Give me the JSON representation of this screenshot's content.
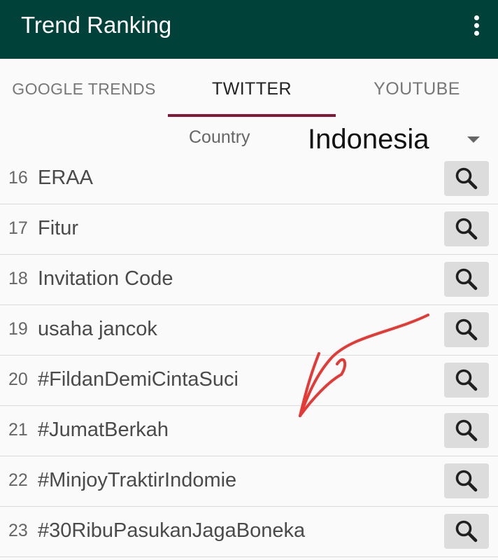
{
  "app": {
    "title": "Trend Ranking",
    "menu_icon": "more-vert-icon",
    "bar_color": "#00423a"
  },
  "tabs": [
    {
      "label": "GOOGLE TRENDS",
      "selected": false
    },
    {
      "label": "TWITTER",
      "selected": true
    },
    {
      "label": "YOUTUBE",
      "selected": false
    }
  ],
  "accent_color": "#8a1538",
  "country": {
    "label": "Country",
    "value": "Indonesia"
  },
  "trends": [
    {
      "rank": "16",
      "term": "ERAA"
    },
    {
      "rank": "17",
      "term": "Fitur"
    },
    {
      "rank": "18",
      "term": "Invitation Code"
    },
    {
      "rank": "19",
      "term": "usaha jancok"
    },
    {
      "rank": "20",
      "term": "#FildanDemiCintaSuci"
    },
    {
      "rank": "21",
      "term": "#JumatBerkah"
    },
    {
      "rank": "22",
      "term": "#MinjoyTraktirIndomie"
    },
    {
      "rank": "23",
      "term": "#30RibuPasukanJagaBoneka"
    }
  ],
  "annotation": {
    "icon": "hand-drawn-arrow",
    "color": "#e53935"
  }
}
